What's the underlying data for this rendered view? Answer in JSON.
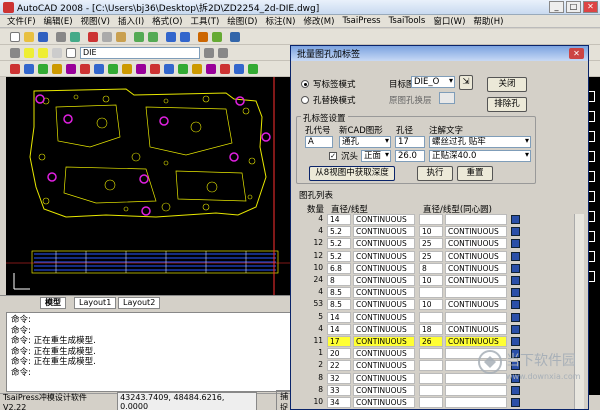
{
  "window": {
    "title": "AutoCAD 2008 - [C:\\Users\\bj36\\Desktop\\拆2D\\ZD2254_2d-DIE.dwg]"
  },
  "menubar": {
    "items": [
      "文件(F)",
      "编辑(E)",
      "视图(V)",
      "插入(I)",
      "格式(O)",
      "工具(T)",
      "绘图(D)",
      "标注(N)",
      "修改(M)",
      "TsaiPress",
      "TsaiTools",
      "窗口(W)",
      "帮助(H)"
    ]
  },
  "toolbar": {
    "layer_name": "DIE"
  },
  "layout_tabs": [
    "模型",
    "Layout1",
    "Layout2"
  ],
  "command_lines": [
    "命令:",
    "命令:",
    "命令: 正在重生成模型.",
    "命令: 正在重生成模型.",
    "命令: 正在重生成模型.",
    "命令:"
  ],
  "status": {
    "product": "TsaiPress冲模设计软件 V2.22",
    "coords": "43243.7409, 48484.6216, 0.0000",
    "snap": "捕捉"
  },
  "dialog": {
    "title": "批量图孔加标签",
    "mode_write": "写标签模式",
    "mode_replace": "孔替换模式",
    "target_layer_label": "目标图层",
    "target_layer_value": "DIE_O",
    "orig_layer_label": "原图孔换层",
    "close_label": "关闭",
    "exclude_label": "排除孔",
    "settings_title": "孔标签设置",
    "hole_code_label": "孔代号",
    "new_cad_label": "新CAD图形",
    "diameter_label": "孔径",
    "note_label": "注解文字",
    "hole_code_value": "A",
    "hole_type_value": "通孔",
    "diameter_value": "17",
    "note_value": "螺丝过孔 贴牢",
    "counterbore_label": "沉头",
    "cb_side_value": "正面",
    "cb_diameter_value": "26.0",
    "cb_note_value": "正贴深40.0",
    "get_depth_label": "从8视图中获取深度",
    "execute_label": "执行",
    "reset_label": "重置",
    "list_title": "图孔列表",
    "col_count": "数量",
    "col_diameter": "直径/线型",
    "col_concentric": "直径/线型(同心圆)",
    "rows": [
      {
        "count": "4",
        "dia": "14",
        "lt": "CONTINUOUS",
        "cdia": "",
        "clt": "",
        "hl": false
      },
      {
        "count": "4",
        "dia": "5.2",
        "lt": "CONTINUOUS",
        "cdia": "10",
        "clt": "CONTINUOUS",
        "hl": false
      },
      {
        "count": "12",
        "dia": "5.2",
        "lt": "CONTINUOUS",
        "cdia": "25",
        "clt": "CONTINUOUS",
        "hl": false
      },
      {
        "count": "12",
        "dia": "5.2",
        "lt": "CONTINUOUS",
        "cdia": "25",
        "clt": "CONTINUOUS",
        "hl": false
      },
      {
        "count": "10",
        "dia": "6.8",
        "lt": "CONTINUOUS",
        "cdia": "8",
        "clt": "CONTINUOUS",
        "hl": false
      },
      {
        "count": "24",
        "dia": "8",
        "lt": "CONTINUOUS",
        "cdia": "10",
        "clt": "CONTINUOUS",
        "hl": false
      },
      {
        "count": "4",
        "dia": "8.5",
        "lt": "CONTINUOUS",
        "cdia": "",
        "clt": "",
        "hl": false
      },
      {
        "count": "53",
        "dia": "8.5",
        "lt": "CONTINUOUS",
        "cdia": "10",
        "clt": "CONTINUOUS",
        "hl": false
      },
      {
        "count": "5",
        "dia": "14",
        "lt": "CONTINUOUS",
        "cdia": "",
        "clt": "",
        "hl": false
      },
      {
        "count": "4",
        "dia": "14",
        "lt": "CONTINUOUS",
        "cdia": "18",
        "clt": "CONTINUOUS",
        "hl": false
      },
      {
        "count": "11",
        "dia": "17",
        "lt": "CONTINUOUS",
        "cdia": "26",
        "clt": "CONTINUOUS",
        "hl": true
      },
      {
        "count": "1",
        "dia": "20",
        "lt": "CONTINUOUS",
        "cdia": "",
        "clt": "",
        "hl": false
      },
      {
        "count": "2",
        "dia": "22",
        "lt": "CONTINUOUS",
        "cdia": "",
        "clt": "",
        "hl": false
      },
      {
        "count": "8",
        "dia": "32",
        "lt": "CONTINUOUS",
        "cdia": "",
        "clt": "",
        "hl": false
      },
      {
        "count": "8",
        "dia": "33",
        "lt": "CONTINUOUS",
        "cdia": "",
        "clt": "",
        "hl": false
      },
      {
        "count": "10",
        "dia": "34",
        "lt": "CONTINUOUS",
        "cdia": "",
        "clt": "",
        "hl": false
      }
    ]
  },
  "watermark": {
    "text": "当下软件园",
    "url": "www.downxia.com"
  },
  "colors": {
    "highlight": "#ffff33",
    "drawing_bg": "#000000",
    "holes": "#e020e0",
    "outline": "#e8e800"
  }
}
